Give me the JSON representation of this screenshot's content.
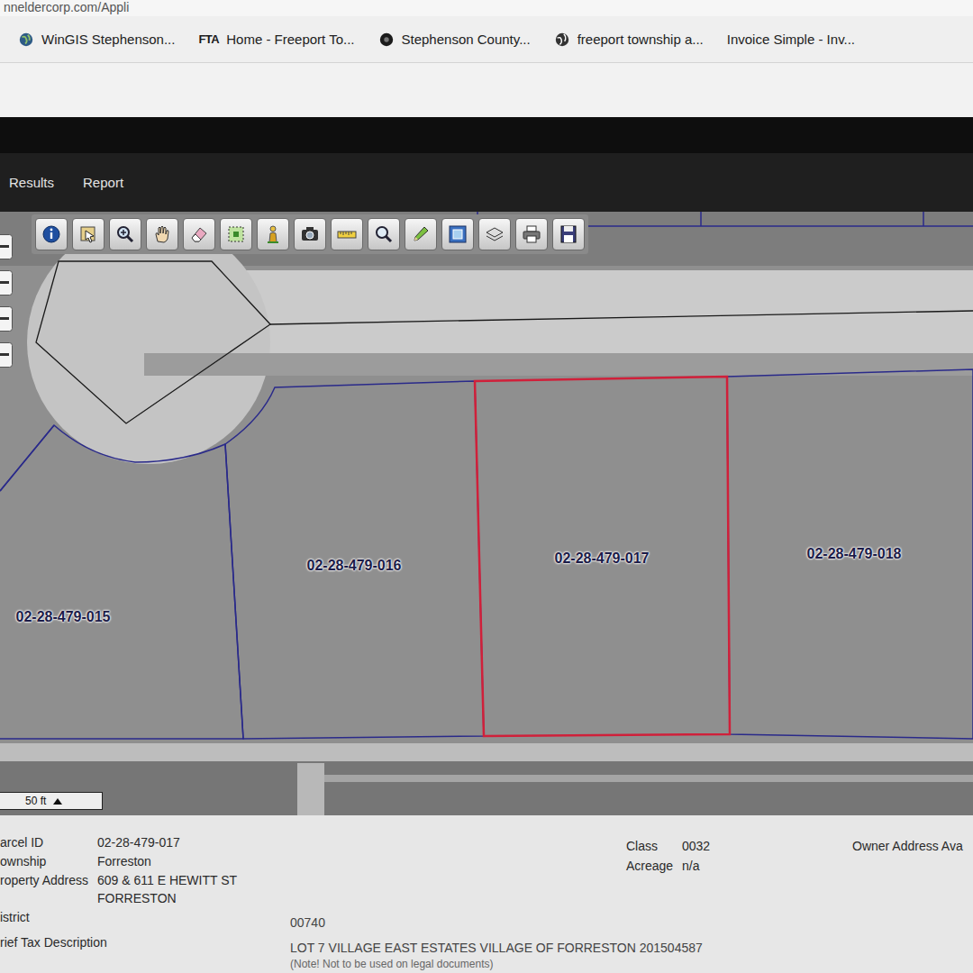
{
  "browser": {
    "url": "nneldercorp.com/Appli",
    "bookmarks": [
      {
        "label": "WinGIS Stephenson..."
      },
      {
        "label": "Home - Freeport To...",
        "badge": "FTA"
      },
      {
        "label": "Stephenson County..."
      },
      {
        "label": "freeport township a..."
      },
      {
        "label": "Invoice Simple - Inv..."
      }
    ]
  },
  "nav": [
    {
      "label": "Results"
    },
    {
      "label": "Report"
    }
  ],
  "map": {
    "parcels": [
      {
        "id": "02-28-479-015",
        "selected": false
      },
      {
        "id": "02-28-479-016",
        "selected": false
      },
      {
        "id": "02-28-479-017",
        "selected": true
      },
      {
        "id": "02-28-479-018",
        "selected": false
      }
    ],
    "scale": "50 ft"
  },
  "details": {
    "fields": [
      {
        "label": "arcel ID",
        "lines": [
          "02-28-479-017"
        ]
      },
      {
        "label": "ownship",
        "lines": [
          "Forreston"
        ]
      },
      {
        "label": "roperty Address",
        "lines": [
          "609 & 611 E HEWITT ST",
          "FORRESTON"
        ]
      }
    ],
    "stats": [
      {
        "label": "Class",
        "value": "0032"
      },
      {
        "label": "Acreage",
        "value": "n/a"
      }
    ],
    "owner": "Owner Address Ava",
    "wide_fields": [
      {
        "label": "istrict",
        "value": "00740",
        "note": ""
      },
      {
        "label": "rief Tax Description",
        "value": "LOT 7 VILLAGE EAST ESTATES VILLAGE OF FORRESTON 201504587",
        "note": "(Note! Not to be used on legal documents)"
      }
    ]
  }
}
